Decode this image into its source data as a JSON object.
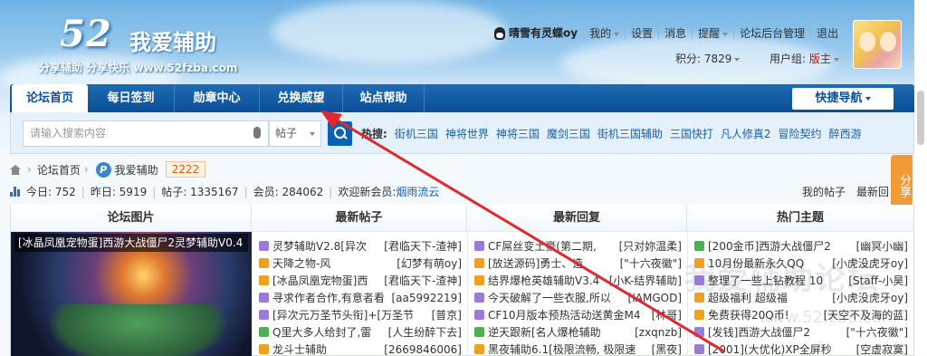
{
  "logo": {
    "number": "52",
    "name": "我爱辅助",
    "slogan": "分享辅助  分享快乐  www.52fzba.com"
  },
  "user": {
    "username": "晴雪有灵蝶oy",
    "links": [
      "我的",
      "设置",
      "消息",
      "提醒",
      "论坛后台管理",
      "退出"
    ],
    "score_label": "积分: 7829",
    "group_label": "用户组: ",
    "group_value": "版主"
  },
  "nav": {
    "items": [
      "论坛首页",
      "每日签到",
      "勋章中心",
      "兑换威望",
      "站点帮助"
    ],
    "quick_nav": "快捷导航"
  },
  "search": {
    "placeholder": "请输入搜索内容",
    "scope": "帖子",
    "hot_label": "热搜:",
    "hot_terms": [
      "街机三国",
      "神将世界",
      "神将三国",
      "魔剑三国",
      "街机三国辅助",
      "三国快打",
      "凡人修真2",
      "冒险契约",
      "醉西游"
    ]
  },
  "breadcrumb": {
    "home": "论坛首页",
    "forum": "我爱辅助",
    "count": "2222"
  },
  "stats": {
    "today": "今日: 752",
    "yesterday": "昨日: 5919",
    "posts": "帖子: 1335167",
    "members": "会员: 284062",
    "welcome": "欢迎新会员: ",
    "new_member": "烟雨流云",
    "my_posts": "我的帖子",
    "latest": "最新回"
  },
  "share_tab": "分享",
  "columns": [
    "论坛图片",
    "最新帖子",
    "最新回复",
    "热门主题"
  ],
  "image_caption": "[冰晶凤凰宠物蛋]西游大战僵尸2灵梦辅助V0.4",
  "latest_posts": [
    {
      "title": "灵梦辅助V2.8[异次",
      "author": "[君临天下-渣神]"
    },
    {
      "title": "天降之物-风",
      "author": "[幻梦有萌oy]"
    },
    {
      "title": "[冰晶凤凰宠物蛋]西",
      "author": "[君临天下-渣神]"
    },
    {
      "title": "寻求作者合作,有意者看",
      "author": "[aa5992219]"
    },
    {
      "title": "[异次元万圣节头衔]+[万圣节",
      "author": "[普京]"
    },
    {
      "title": "Q里大多人给封了,雷",
      "author": "[人生纷醉下去]"
    },
    {
      "title": "龙斗士辅助",
      "author": "[2669846006]"
    }
  ],
  "latest_replies": [
    {
      "title": "CF屌丝变土豪(第二期,",
      "author": "[只对妳温柔]"
    },
    {
      "title": "[放送源码]勇士、造",
      "author": "[\"十六夜徽\"]"
    },
    {
      "title": "结界爆枪英雄辅助V3.4",
      "author": "[小K-结界辅助]"
    },
    {
      "title": "今天破解了一些衣服,所以",
      "author": "[IAMGOD]"
    },
    {
      "title": "CF10月版本预热活动送黄金M4",
      "author": "[林哥]"
    },
    {
      "title": "逆天跟新[名人爆枪辅助",
      "author": "[zxqnzb]"
    },
    {
      "title": "黑夜辅助6.1[极限流畅, 极限速",
      "author": "[黑夜]"
    }
  ],
  "hot_topics": [
    {
      "title": "[200金币]西游大战僵尸2",
      "author": "[幽冥小幽]"
    },
    {
      "title": "10月份最新永久QQ",
      "author": "[小虎没虎牙oy]"
    },
    {
      "title": "整理了一些上钻教程 10",
      "author": "[Staff-小昊]"
    },
    {
      "title": "超级福利 超级福",
      "author": "[小虎没虎牙oy]"
    },
    {
      "title": "免费获得20Q币!",
      "author": "[天空不及海的蓝]"
    },
    {
      "title": "[发钱]西游大战僵尸2",
      "author": "[\"十六夜徽\"]"
    },
    {
      "title": "[2001](大优化)XP全屏秒",
      "author": "[空虚寂寞]"
    }
  ],
  "watermark": "我爱辅助论坛",
  "watermark_url": "www.52fzba.com"
}
